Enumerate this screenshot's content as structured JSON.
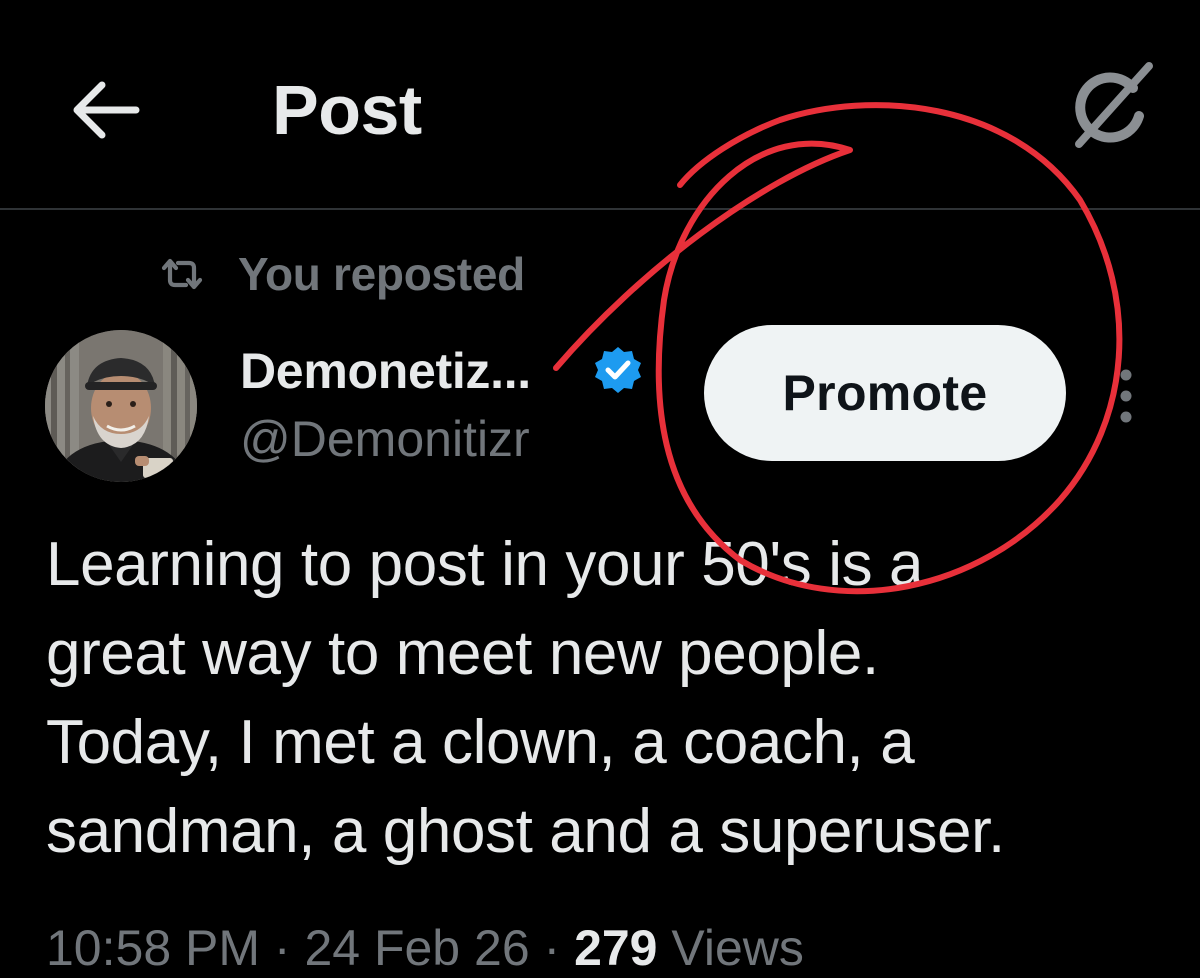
{
  "header": {
    "title": "Post",
    "back_icon": "arrow-left-icon",
    "grok_icon": "grok-icon"
  },
  "repost": {
    "label": "You reposted",
    "icon": "repost-icon"
  },
  "author": {
    "display_name": "Demonetiz...",
    "handle": "@Demonitizr",
    "verified": true
  },
  "actions": {
    "promote_label": "Promote",
    "more_icon": "more-vertical-icon"
  },
  "post": {
    "text": "Learning to post in your 50's is a\ngreat way to meet new people.\nToday, I met a clown, a coach, a\nsandman, a ghost and a superuser."
  },
  "meta": {
    "time": "10:58 PM",
    "separator": " · ",
    "date": "24 Feb 26",
    "views_count": "279",
    "views_label": " Views"
  },
  "colors": {
    "background": "#000000",
    "text_primary": "#e7e9ea",
    "text_secondary": "#71767b",
    "divider": "#2f3336",
    "verified_blue": "#1d9bf0",
    "promote_bg": "#eff3f4",
    "annotation_red": "#e8303a"
  }
}
